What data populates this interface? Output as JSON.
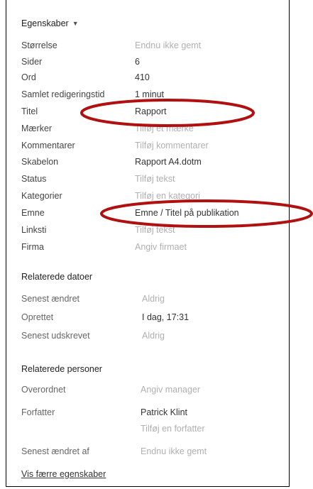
{
  "title": "Egenskaber",
  "properties": [
    {
      "label": "Størrelse",
      "value": "Endnu ikke gemt"
    },
    {
      "label": "Sider",
      "value": "6"
    },
    {
      "label": "Ord",
      "value": "410"
    },
    {
      "label": "Samlet redigeringstid",
      "value": "1 minut"
    },
    {
      "label": "Titel",
      "value": "Rapport"
    },
    {
      "label": "Mærker",
      "value": "Tilføj et mærke"
    },
    {
      "label": "Kommentarer",
      "value": "Tilføj kommentarer"
    },
    {
      "label": "Skabelon",
      "value": "Rapport A4.dotm"
    },
    {
      "label": "Status",
      "value": "Tilføj tekst"
    },
    {
      "label": "Kategorier",
      "value": "Tilføj en kategori"
    },
    {
      "label": "Emne",
      "value": "Emne / Titel på publikation"
    },
    {
      "label": "Linksti",
      "value": "Tilføj tekst"
    },
    {
      "label": "Firma",
      "value": "Angiv firmaet"
    }
  ],
  "related_dates": {
    "title": "Relaterede datoer",
    "items": [
      {
        "label": "Senest ændret",
        "value": "Aldrig"
      },
      {
        "label": "Oprettet",
        "value": "I dag, 17:31"
      },
      {
        "label": "Senest udskrevet",
        "value": "Aldrig"
      }
    ]
  },
  "related_people": {
    "title": "Relaterede personer",
    "manager": {
      "label": "Overordnet",
      "value": "Angiv manager"
    },
    "author": {
      "label": "Forfatter",
      "value": "Patrick Klint",
      "add": "Tilføj en forfatter"
    },
    "last_modified_by": {
      "label": "Senest ændret af",
      "value": "Endnu ikke gemt"
    }
  },
  "show_fewer": "Vis færre egenskaber",
  "annotation_color": "#b01010"
}
